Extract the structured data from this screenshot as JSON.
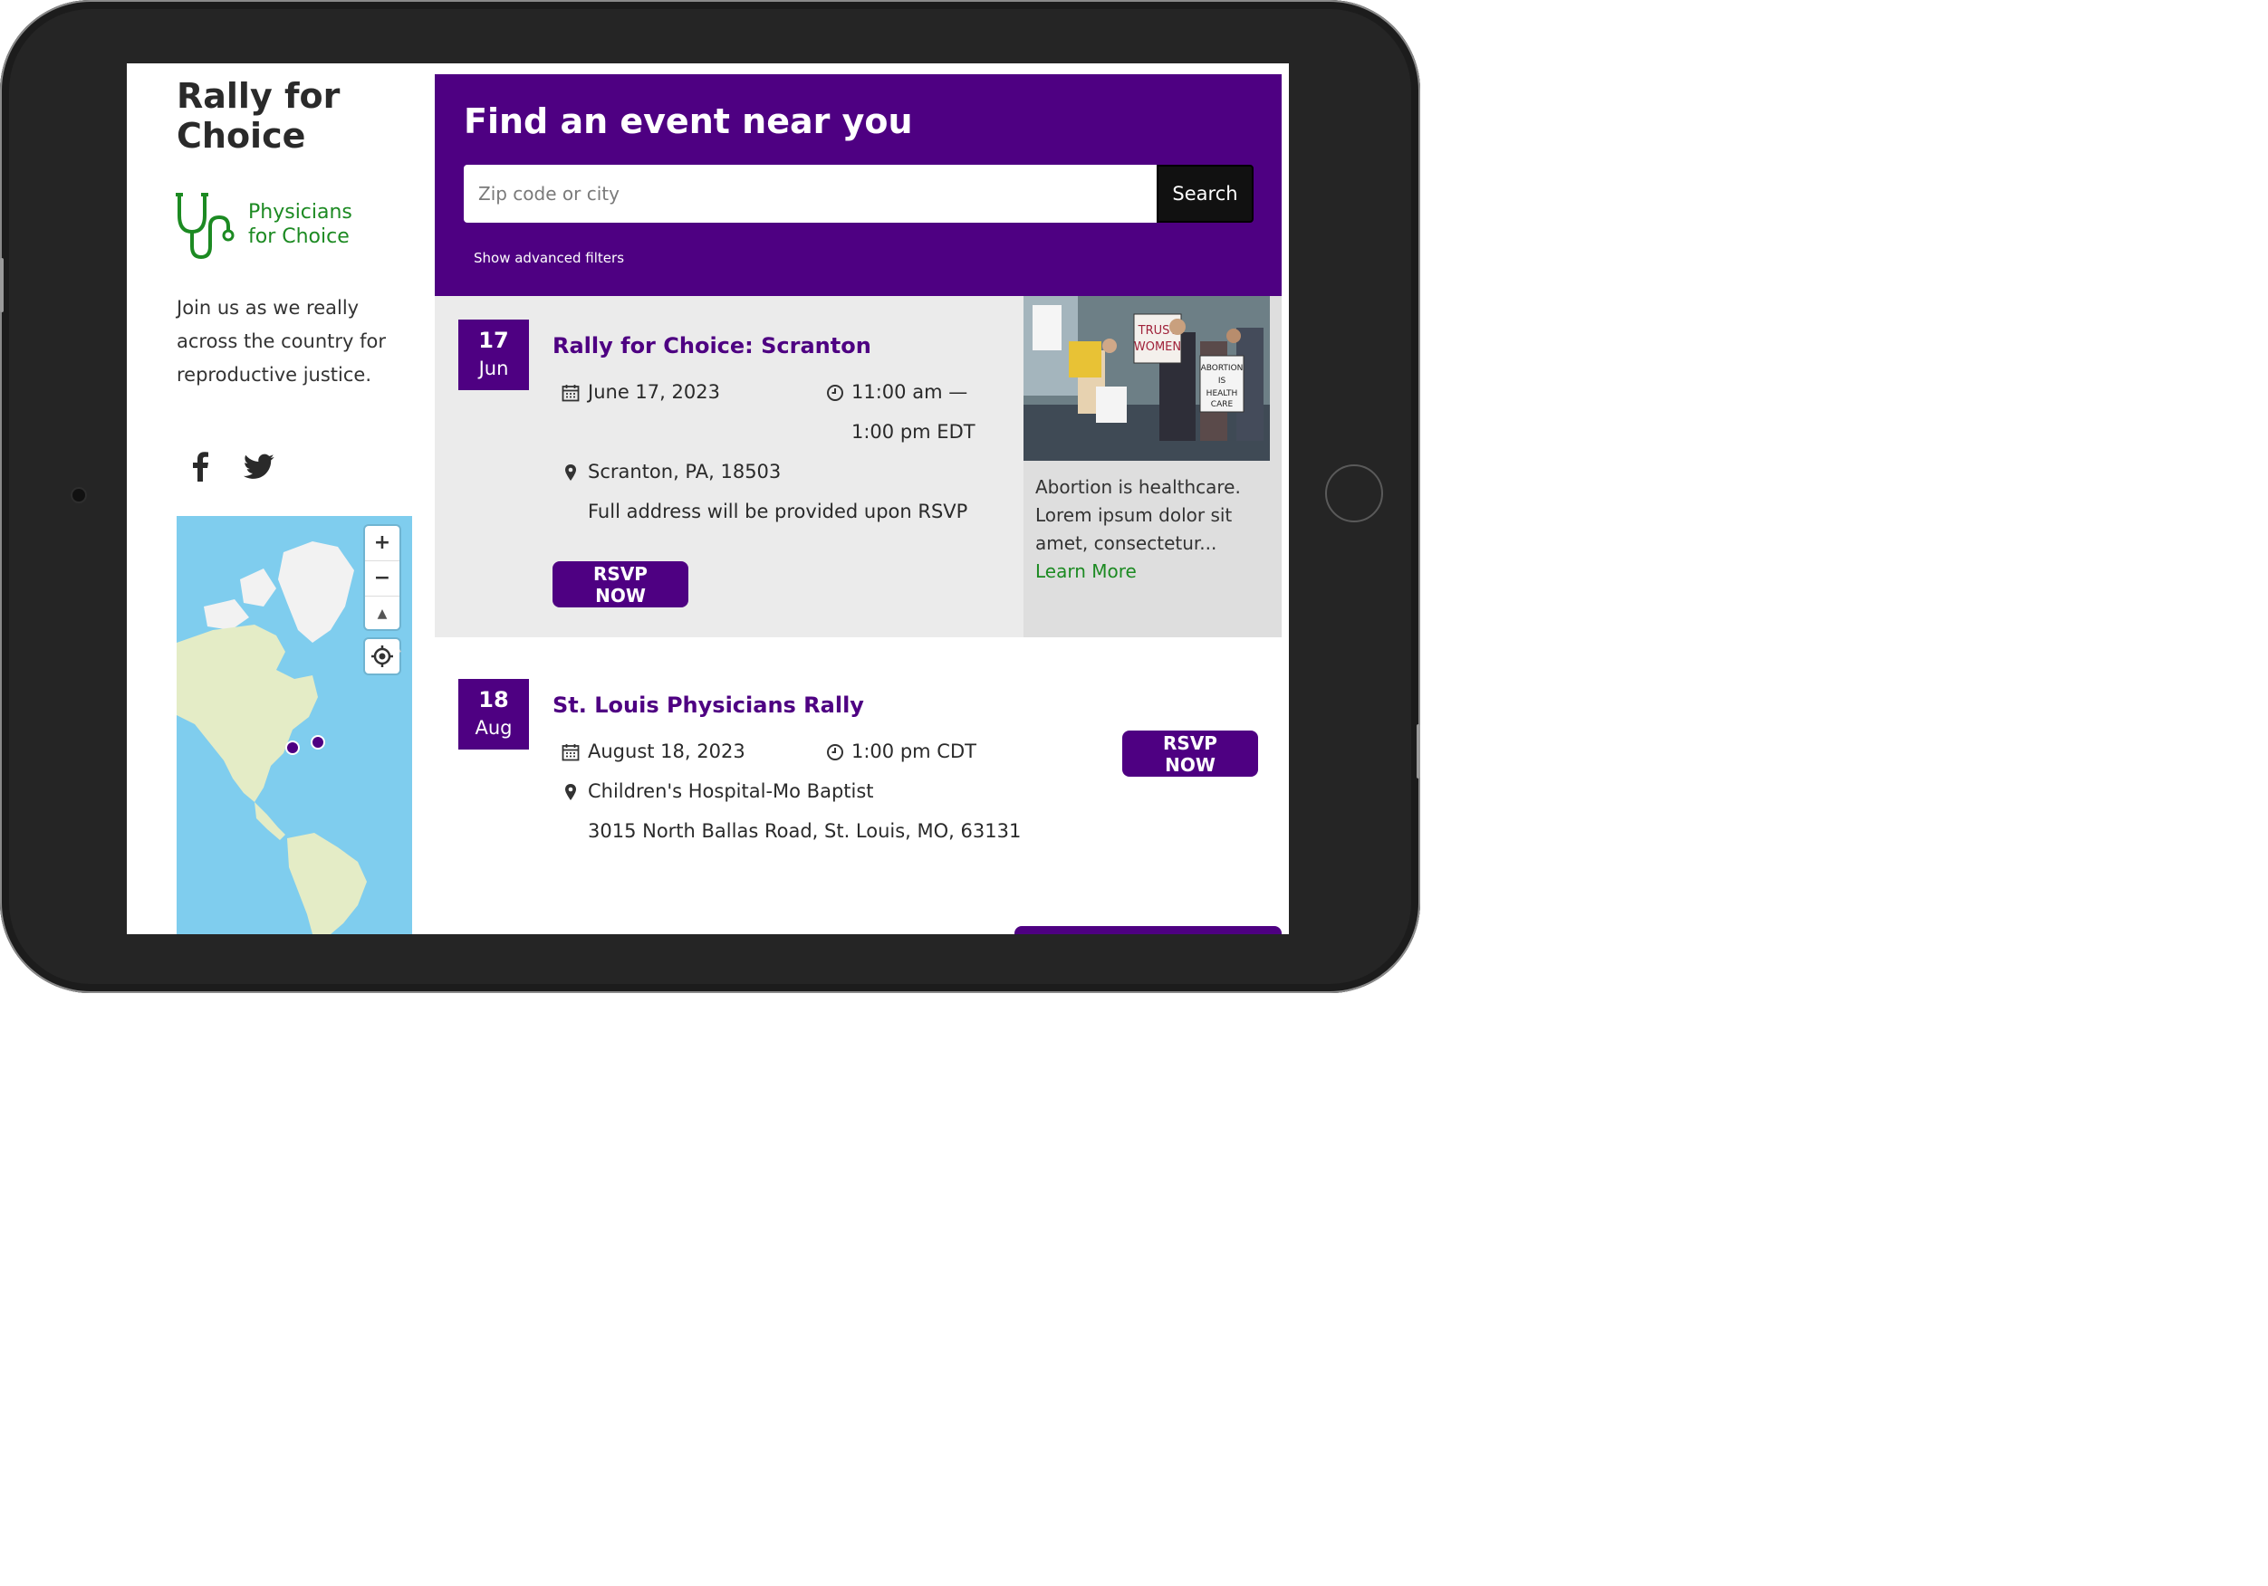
{
  "sidebar": {
    "site_title": "Rally for Choice",
    "logo_text": "Physicians for Choice",
    "tagline": "Join us as we really across the country for reproductive justice.",
    "social": [
      "facebook-icon",
      "twitter-icon"
    ],
    "map_controls": {
      "zoom_in": "+",
      "zoom_out": "−",
      "compass": "▲",
      "locate": "locate-icon"
    }
  },
  "search": {
    "heading": "Find an event near you",
    "placeholder": "Zip code or city",
    "button_label": "Search",
    "filters_link": "Show advanced filters"
  },
  "events": [
    {
      "day": "17",
      "month": "Jun",
      "title": "Rally for Choice: Scranton",
      "date": "June 17, 2023",
      "time_line1": "11:00 am —",
      "time_line2": "1:00 pm EDT",
      "location": "Scranton, PA, 18503",
      "address": "Full address will be provided upon RSVP",
      "rsvp_label": "RSVP NOW",
      "promo": {
        "text": "Abortion is healthcare. Lorem ipsum dolor sit amet, consectetur...",
        "link": "Learn More",
        "signs": [
          "TRUST WOMEN",
          "ABORTION IS HEALTH CARE"
        ]
      }
    },
    {
      "day": "18",
      "month": "Aug",
      "title": "St. Louis Physicians Rally",
      "date": "August 18, 2023",
      "time": "1:00 pm CDT",
      "location": "Children's Hospital-Mo Baptist",
      "address": "3015 North Ballas Road, St. Louis, MO, 63131",
      "rsvp_label": "RSVP NOW"
    }
  ],
  "colors": {
    "brand_purple": "#4e0082",
    "logo_green": "#1c8a22",
    "event_bg": "#ebebeb",
    "promo_bg": "#dedede",
    "map_water": "#7fcdee",
    "map_land": "#e4ecc6"
  }
}
